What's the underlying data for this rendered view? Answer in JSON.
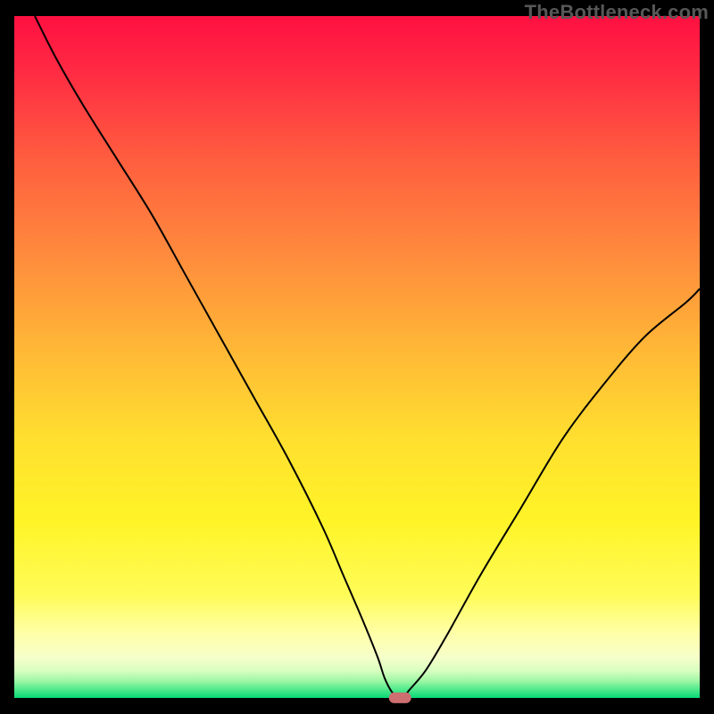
{
  "watermark": "TheBottleneck.com",
  "colors": {
    "black": "#000000",
    "curve": "#000000",
    "marker": "#cd6e70",
    "gradient_stops": [
      {
        "offset": 0,
        "color": "#ff1041"
      },
      {
        "offset": 0.08,
        "color": "#ff2a43"
      },
      {
        "offset": 0.2,
        "color": "#ff5a3f"
      },
      {
        "offset": 0.35,
        "color": "#ff8b3d"
      },
      {
        "offset": 0.5,
        "color": "#ffbb36"
      },
      {
        "offset": 0.62,
        "color": "#ffdf2f"
      },
      {
        "offset": 0.74,
        "color": "#fff427"
      },
      {
        "offset": 0.85,
        "color": "#fffc58"
      },
      {
        "offset": 0.905,
        "color": "#ffffa8"
      },
      {
        "offset": 0.94,
        "color": "#f6ffc9"
      },
      {
        "offset": 0.96,
        "color": "#d9ffc0"
      },
      {
        "offset": 0.975,
        "color": "#9ef7a4"
      },
      {
        "offset": 0.988,
        "color": "#4de98b"
      },
      {
        "offset": 1.0,
        "color": "#06d977"
      }
    ]
  },
  "chart_data": {
    "type": "line",
    "title": "",
    "xlabel": "",
    "ylabel": "",
    "xlim": [
      0,
      100
    ],
    "ylim": [
      0,
      100
    ],
    "grid": false,
    "legend": false,
    "series": [
      {
        "name": "bottleneck-curve",
        "x": [
          3,
          6,
          10,
          15,
          20,
          25,
          30,
          35,
          40,
          45,
          48,
          51,
          53,
          54,
          55,
          56,
          56.8,
          57.5,
          60,
          63,
          68,
          74,
          80,
          86,
          92,
          98,
          100
        ],
        "y": [
          100,
          94,
          87,
          79,
          71,
          62,
          53,
          44,
          35,
          25,
          18,
          11,
          6,
          3,
          1,
          0,
          0,
          1,
          4,
          9,
          18,
          28,
          38,
          46,
          53,
          58,
          60
        ]
      }
    ],
    "annotations": [
      {
        "name": "min-marker",
        "shape": "pill",
        "x": 56.3,
        "y": 0,
        "width_pct": 3.2,
        "height_pct": 1.6,
        "color": "#cd6e70"
      }
    ]
  }
}
